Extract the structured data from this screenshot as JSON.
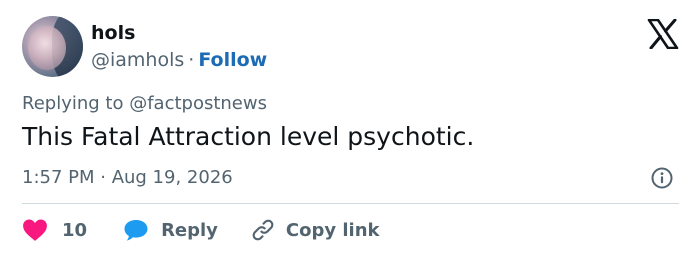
{
  "user": {
    "display_name": "hols",
    "handle": "@iamhols",
    "separator": "·",
    "follow_label": "Follow"
  },
  "tweet": {
    "replying_to": "Replying to @factpostnews",
    "text": "This Fatal Attraction level psychotic.",
    "timestamp": "1:57 PM · Aug 19, 2026"
  },
  "actions": {
    "like_count": "10",
    "reply_label": "Reply",
    "copy_link_label": "Copy link"
  },
  "icons": {
    "logo": "x-logo-icon",
    "info": "info-icon",
    "like": "heart-icon",
    "reply": "speech-bubble-icon",
    "copy": "link-icon"
  },
  "colors": {
    "heart": "#f91880",
    "reply_bubble": "#1d9bf0",
    "follow": "#1d6bb5",
    "muted_text": "#536471"
  }
}
